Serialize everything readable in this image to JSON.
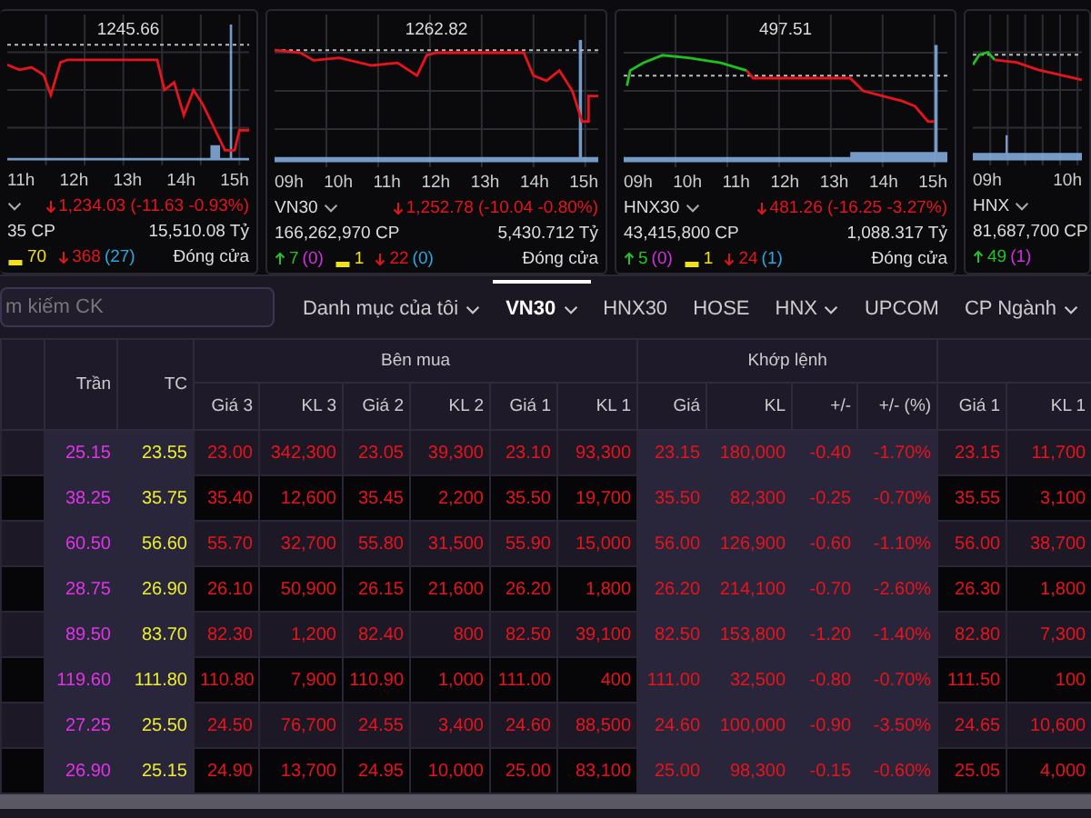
{
  "index_cards": [
    {
      "dropdown": true,
      "reference": "1245.66",
      "hours": [
        "11h",
        "12h",
        "13h",
        "14h",
        "15h"
      ],
      "change": {
        "text": "1,234.03 (-11.63 -0.93%)"
      },
      "volume": "35 CP",
      "value": "15,510.08 Tỷ",
      "counts": [
        {
          "kind": "flat",
          "number": "70"
        },
        {
          "kind": "down",
          "number": "368",
          "paren": "(27)"
        }
      ],
      "status": "Đóng cửa"
    },
    {
      "name": "VN30",
      "dropdown": true,
      "reference": "1262.82",
      "hours": [
        "09h",
        "10h",
        "11h",
        "12h",
        "13h",
        "14h",
        "15h"
      ],
      "change": {
        "text": "1,252.78 (-10.04 -0.80%)"
      },
      "volume": "166,262,970 CP",
      "value": "5,430.712 Tỷ",
      "counts": [
        {
          "kind": "up",
          "number": "7",
          "paren": "(0)"
        },
        {
          "kind": "flat",
          "number": "1"
        },
        {
          "kind": "down",
          "number": "22",
          "paren": "(0)"
        }
      ],
      "status": "Đóng cửa"
    },
    {
      "name": "HNX30",
      "dropdown": true,
      "reference": "497.51",
      "hours": [
        "09h",
        "10h",
        "11h",
        "12h",
        "13h",
        "14h",
        "15h"
      ],
      "change": {
        "text": "481.26 (-16.25 -3.27%)"
      },
      "volume": "43,415,800 CP",
      "value": "1,088.317 Tỷ",
      "counts": [
        {
          "kind": "up",
          "number": "5",
          "paren": "(0)"
        },
        {
          "kind": "flat",
          "number": "1"
        },
        {
          "kind": "down",
          "number": "24",
          "paren": "(1)"
        }
      ],
      "status": "Đóng cửa"
    },
    {
      "name": "HNX",
      "dropdown": true,
      "hours": [
        "09h",
        "10h"
      ],
      "volume": "81,687,700 CP",
      "counts": [
        {
          "kind": "up",
          "number": "49",
          "paren": "(1)"
        }
      ]
    }
  ],
  "toolbar": {
    "search": {
      "placeholder": "m kiếm CK"
    },
    "tabs": [
      {
        "label": "Danh mục của tôi",
        "dropdown": true,
        "selected": false
      },
      {
        "label": "VN30",
        "dropdown": true,
        "selected": true
      },
      {
        "label": "HNX30",
        "dropdown": false,
        "selected": false
      },
      {
        "label": "HOSE",
        "dropdown": false,
        "selected": false
      },
      {
        "label": "HNX",
        "dropdown": true,
        "selected": false
      },
      {
        "label": "UPCOM",
        "dropdown": false,
        "selected": false
      },
      {
        "label": "CP Ngành",
        "dropdown": true,
        "selected": false
      }
    ]
  },
  "table": {
    "single_columns": [
      "Trần",
      "TC"
    ],
    "groups": [
      {
        "label": "Bên mua",
        "columns": [
          "Giá 3",
          "KL 3",
          "Giá 2",
          "KL 2",
          "Giá 1",
          "KL 1"
        ]
      },
      {
        "label": "Khớp lệnh",
        "columns": [
          "Giá",
          "KL",
          "+/-",
          "+/- (%)"
        ]
      },
      {
        "columns": [
          "Giá 1",
          "KL 1"
        ]
      }
    ],
    "rows": [
      {
        "ceiling": "25.15",
        "reference": "23.55",
        "cells": [
          "23.00",
          "342,300",
          "23.05",
          "39,300",
          "23.10",
          "93,300",
          "23.15",
          "180,000",
          "-0.40",
          "-1.70%",
          "23.15",
          "11,700"
        ]
      },
      {
        "ceiling": "38.25",
        "reference": "35.75",
        "cells": [
          "35.40",
          "12,600",
          "35.45",
          "2,200",
          "35.50",
          "19,700",
          "35.50",
          "82,300",
          "-0.25",
          "-0.70%",
          "35.55",
          "3,100"
        ]
      },
      {
        "ceiling": "60.50",
        "reference": "56.60",
        "cells": [
          "55.70",
          "32,700",
          "55.80",
          "31,500",
          "55.90",
          "15,000",
          "56.00",
          "126,900",
          "-0.60",
          "-1.10%",
          "56.00",
          "38,700"
        ]
      },
      {
        "ceiling": "28.75",
        "reference": "26.90",
        "cells": [
          "26.10",
          "50,900",
          "26.15",
          "21,600",
          "26.20",
          "1,800",
          "26.20",
          "214,100",
          "-0.70",
          "-2.60%",
          "26.30",
          "1,800"
        ]
      },
      {
        "ceiling": "89.50",
        "reference": "83.70",
        "cells": [
          "82.30",
          "1,200",
          "82.40",
          "800",
          "82.50",
          "39,100",
          "82.50",
          "153,800",
          "-1.20",
          "-1.40%",
          "82.80",
          "7,300"
        ]
      },
      {
        "ceiling": "119.60",
        "reference": "111.80",
        "cells": [
          "110.80",
          "7,900",
          "110.90",
          "1,000",
          "111.00",
          "400",
          "111.00",
          "32,500",
          "-0.80",
          "-0.70%",
          "111.50",
          "100"
        ]
      },
      {
        "ceiling": "27.25",
        "reference": "25.50",
        "cells": [
          "24.50",
          "76,700",
          "24.55",
          "3,400",
          "24.60",
          "88,500",
          "24.60",
          "100,000",
          "-0.90",
          "-3.50%",
          "24.65",
          "10,600"
        ]
      },
      {
        "ceiling": "26.90",
        "reference": "25.15",
        "cells": [
          "24.90",
          "13,700",
          "24.95",
          "10,000",
          "25.00",
          "83,100",
          "25.00",
          "98,300",
          "-0.15",
          "-0.60%",
          "25.05",
          "4,000"
        ]
      }
    ]
  }
}
